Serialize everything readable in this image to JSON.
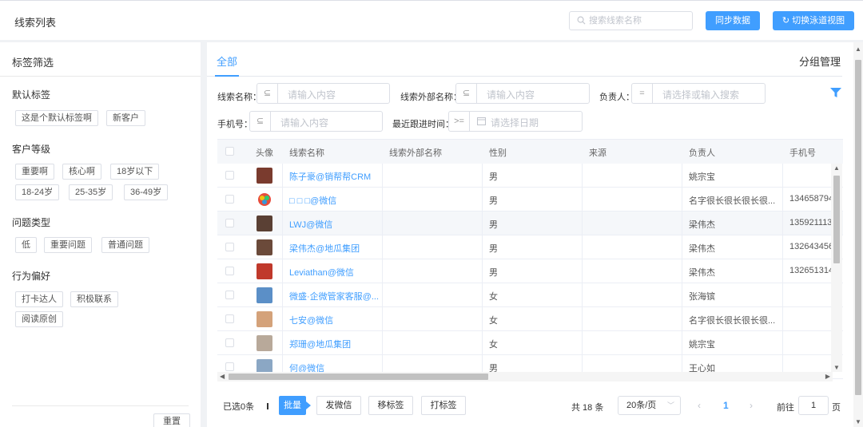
{
  "header": {
    "title": "线索列表",
    "search_placeholder": "搜索线索名称",
    "sync_label": "同步数据",
    "switch_label": "切换泳道视图"
  },
  "sidebar": {
    "title": "标签筛选",
    "groups": [
      {
        "title": "默认标签",
        "tags": [
          "这是个默认标签啊",
          "新客户"
        ]
      },
      {
        "title": "客户等级",
        "tags": [
          "重要啊",
          "核心啊",
          "18岁以下",
          "18-24岁",
          "25-35岁",
          "36-49岁"
        ]
      },
      {
        "title": "问题类型",
        "tags": [
          "低",
          "重要问题",
          "普通问题"
        ]
      },
      {
        "title": "行为偏好",
        "tags": [
          "打卡达人",
          "积极联系",
          "阅读原创"
        ]
      }
    ],
    "reset_label": "重置"
  },
  "main": {
    "tab_all": "全部",
    "group_manage": "分组管理",
    "filters": {
      "name_label": "线索名称：",
      "name_op": "⊆",
      "name_placeholder": "请输入内容",
      "ext_label": "线索外部名称：",
      "ext_op": "⊆",
      "ext_placeholder": "请输入内容",
      "owner_label": "负责人：",
      "owner_op": "=",
      "owner_placeholder": "请选择或输入搜索",
      "phone_label": "手机号：",
      "phone_op": "⊆",
      "phone_placeholder": "请输入内容",
      "follow_label": "最近跟进时间：",
      "follow_op": ">=",
      "follow_placeholder": "请选择日期"
    },
    "table": {
      "columns": [
        "头像",
        "线索名称",
        "线索外部名称",
        "性别",
        "来源",
        "负责人",
        "手机号"
      ],
      "rows": [
        {
          "name": "陈子豪@销帮帮CRM",
          "gender": "男",
          "owner": "姚宗宝",
          "phone": ""
        },
        {
          "name": "□ □ □@微信",
          "gender": "男",
          "owner": "名字很长很长很长很...",
          "phone": "134658794"
        },
        {
          "name": "LWJ@微信",
          "gender": "男",
          "owner": "梁伟杰",
          "phone": "135921113"
        },
        {
          "name": "梁伟杰@地瓜集团",
          "gender": "男",
          "owner": "梁伟杰",
          "phone": "132643456"
        },
        {
          "name": "Leviathan@微信",
          "gender": "男",
          "owner": "梁伟杰",
          "phone": "132651314"
        },
        {
          "name": "微盛·企微管家客服@...",
          "gender": "女",
          "owner": "张海镔",
          "phone": ""
        },
        {
          "name": "七安@微信",
          "gender": "女",
          "owner": "名字很长很长很长很...",
          "phone": ""
        },
        {
          "name": "郑珊@地瓜集团",
          "gender": "女",
          "owner": "姚宗宝",
          "phone": ""
        },
        {
          "name": "何@微信",
          "gender": "男",
          "owner": "王心如",
          "phone": ""
        }
      ]
    },
    "footer": {
      "selected": "已选0条",
      "batch": "批量",
      "send_wechat": "发微信",
      "remove_tag": "移标签",
      "add_tag": "打标签",
      "total": "共 18 条",
      "page_size": "20条/页",
      "current_page": "1",
      "goto_label": "前往",
      "goto_value": "1",
      "page_suffix": "页"
    }
  },
  "colors": {
    "accent": "#409eff",
    "border": "#dcdfe6",
    "background": "#f0f2f5"
  }
}
